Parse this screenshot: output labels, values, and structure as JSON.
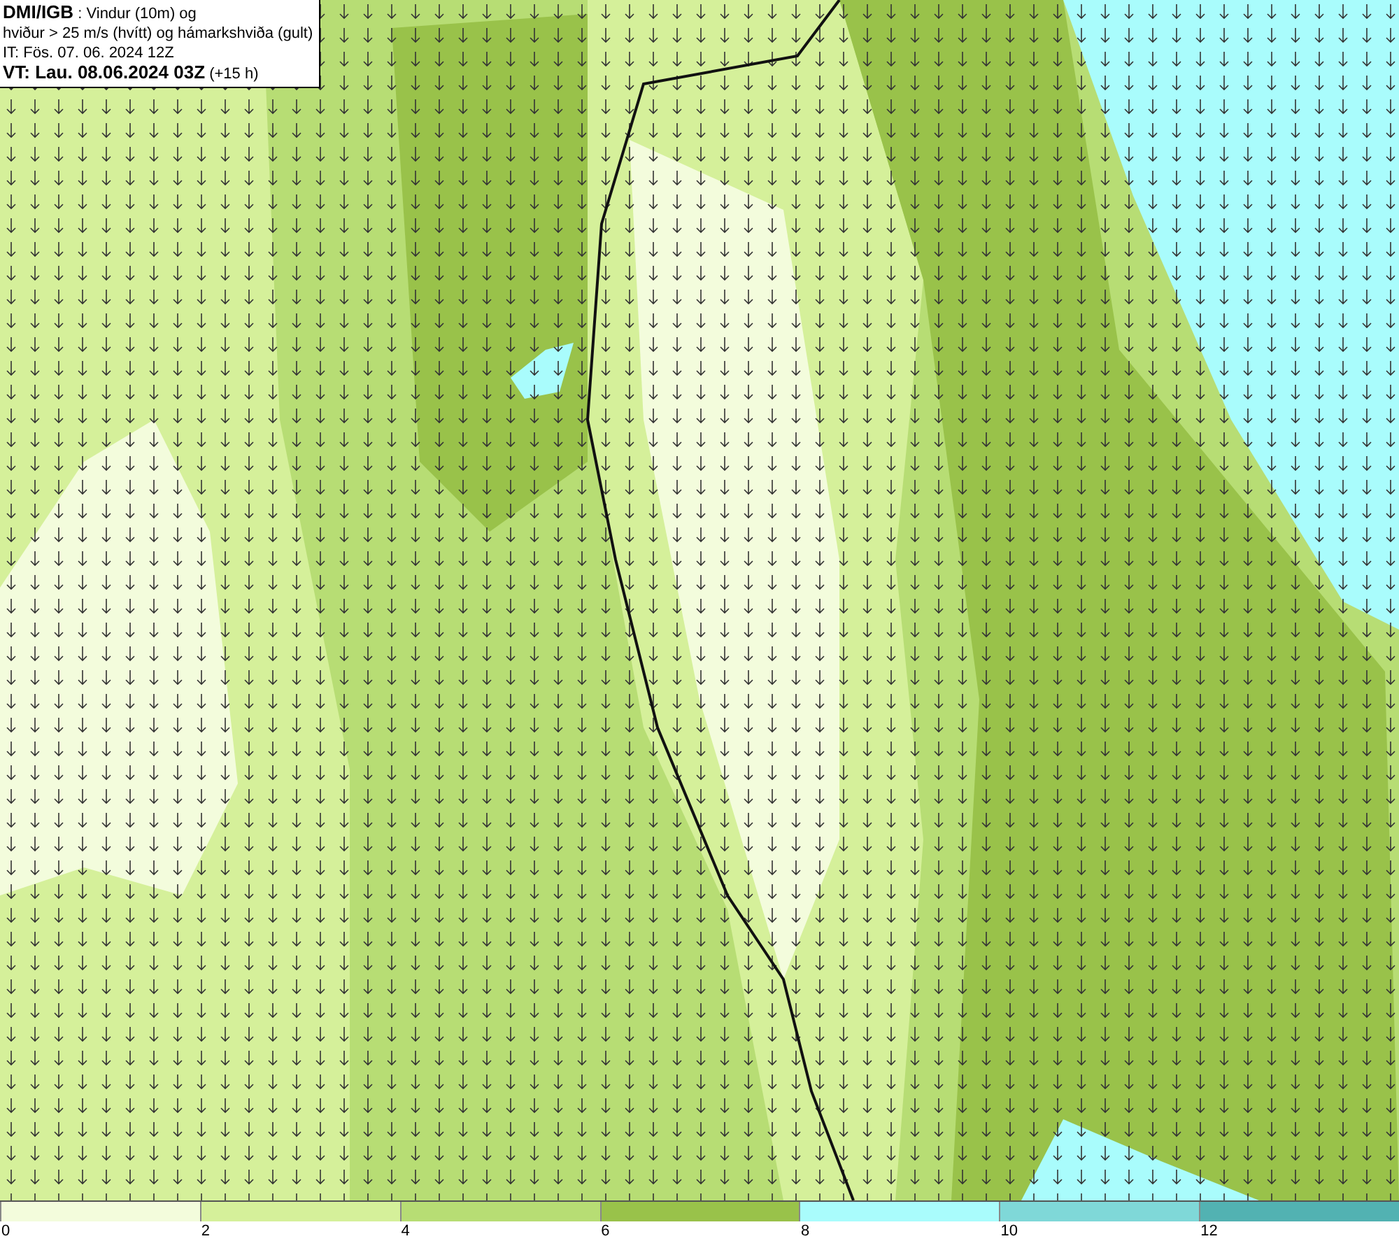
{
  "header": {
    "lines": [
      "**DMI/IGB** : Vindur (10m) og",
      "hviður > 25 m/s (hvítt) og hámarkshviða (gult)",
      "IT: Fös. 07. 06. 2024 12Z",
      "**VT: Lau. 08.06.2024 03Z** (+15 h)"
    ]
  },
  "legend": {
    "bins": [
      {
        "color": "#f3fcdc"
      },
      {
        "color": "#d5f09a"
      },
      {
        "color": "#b7dd74"
      },
      {
        "color": "#99c24a"
      },
      {
        "color": "#a9fcfc"
      },
      {
        "color": "#7fd8d8"
      },
      {
        "color": "#52b2b2"
      }
    ],
    "ticks": [
      "0",
      "2",
      "4",
      "6",
      "8",
      "10",
      "12"
    ]
  }
}
